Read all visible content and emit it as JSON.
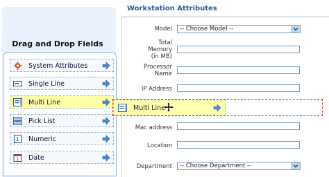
{
  "palette": {
    "title": "Drag and Drop Fields",
    "items": [
      {
        "label": "System Attributes",
        "icon": "gear-icon",
        "selected": false
      },
      {
        "label": "Single Line",
        "icon": "single-line-icon",
        "selected": false
      },
      {
        "label": "Multi Line",
        "icon": "multi-line-icon",
        "selected": true
      },
      {
        "label": "Pick List",
        "icon": "pick-list-icon",
        "selected": false
      },
      {
        "label": "Numeric",
        "icon": "numeric-icon",
        "selected": false
      },
      {
        "label": "Date",
        "icon": "calendar-icon",
        "selected": false
      }
    ]
  },
  "form": {
    "title": "Workstation Attributes",
    "fields": {
      "model_label": "Model",
      "model_value": "-- Choose Model --",
      "memory_label_1": "Total",
      "memory_label_2": "Memory",
      "memory_label_3": "(in MB)",
      "processor_label_1": "Processor",
      "processor_label_2": "Name",
      "ip_label": "IP Address",
      "mac_label": "Mac address",
      "location_label": "Location",
      "department_label": "Department",
      "department_value": "-- Choose Department --"
    }
  },
  "drag": {
    "label": "Multi Line"
  },
  "colors": {
    "accent": "#2a5c9a",
    "selected_bg": "#ffffa8",
    "drop_border": "#cc3333",
    "arrow": "#4a8ad8"
  }
}
